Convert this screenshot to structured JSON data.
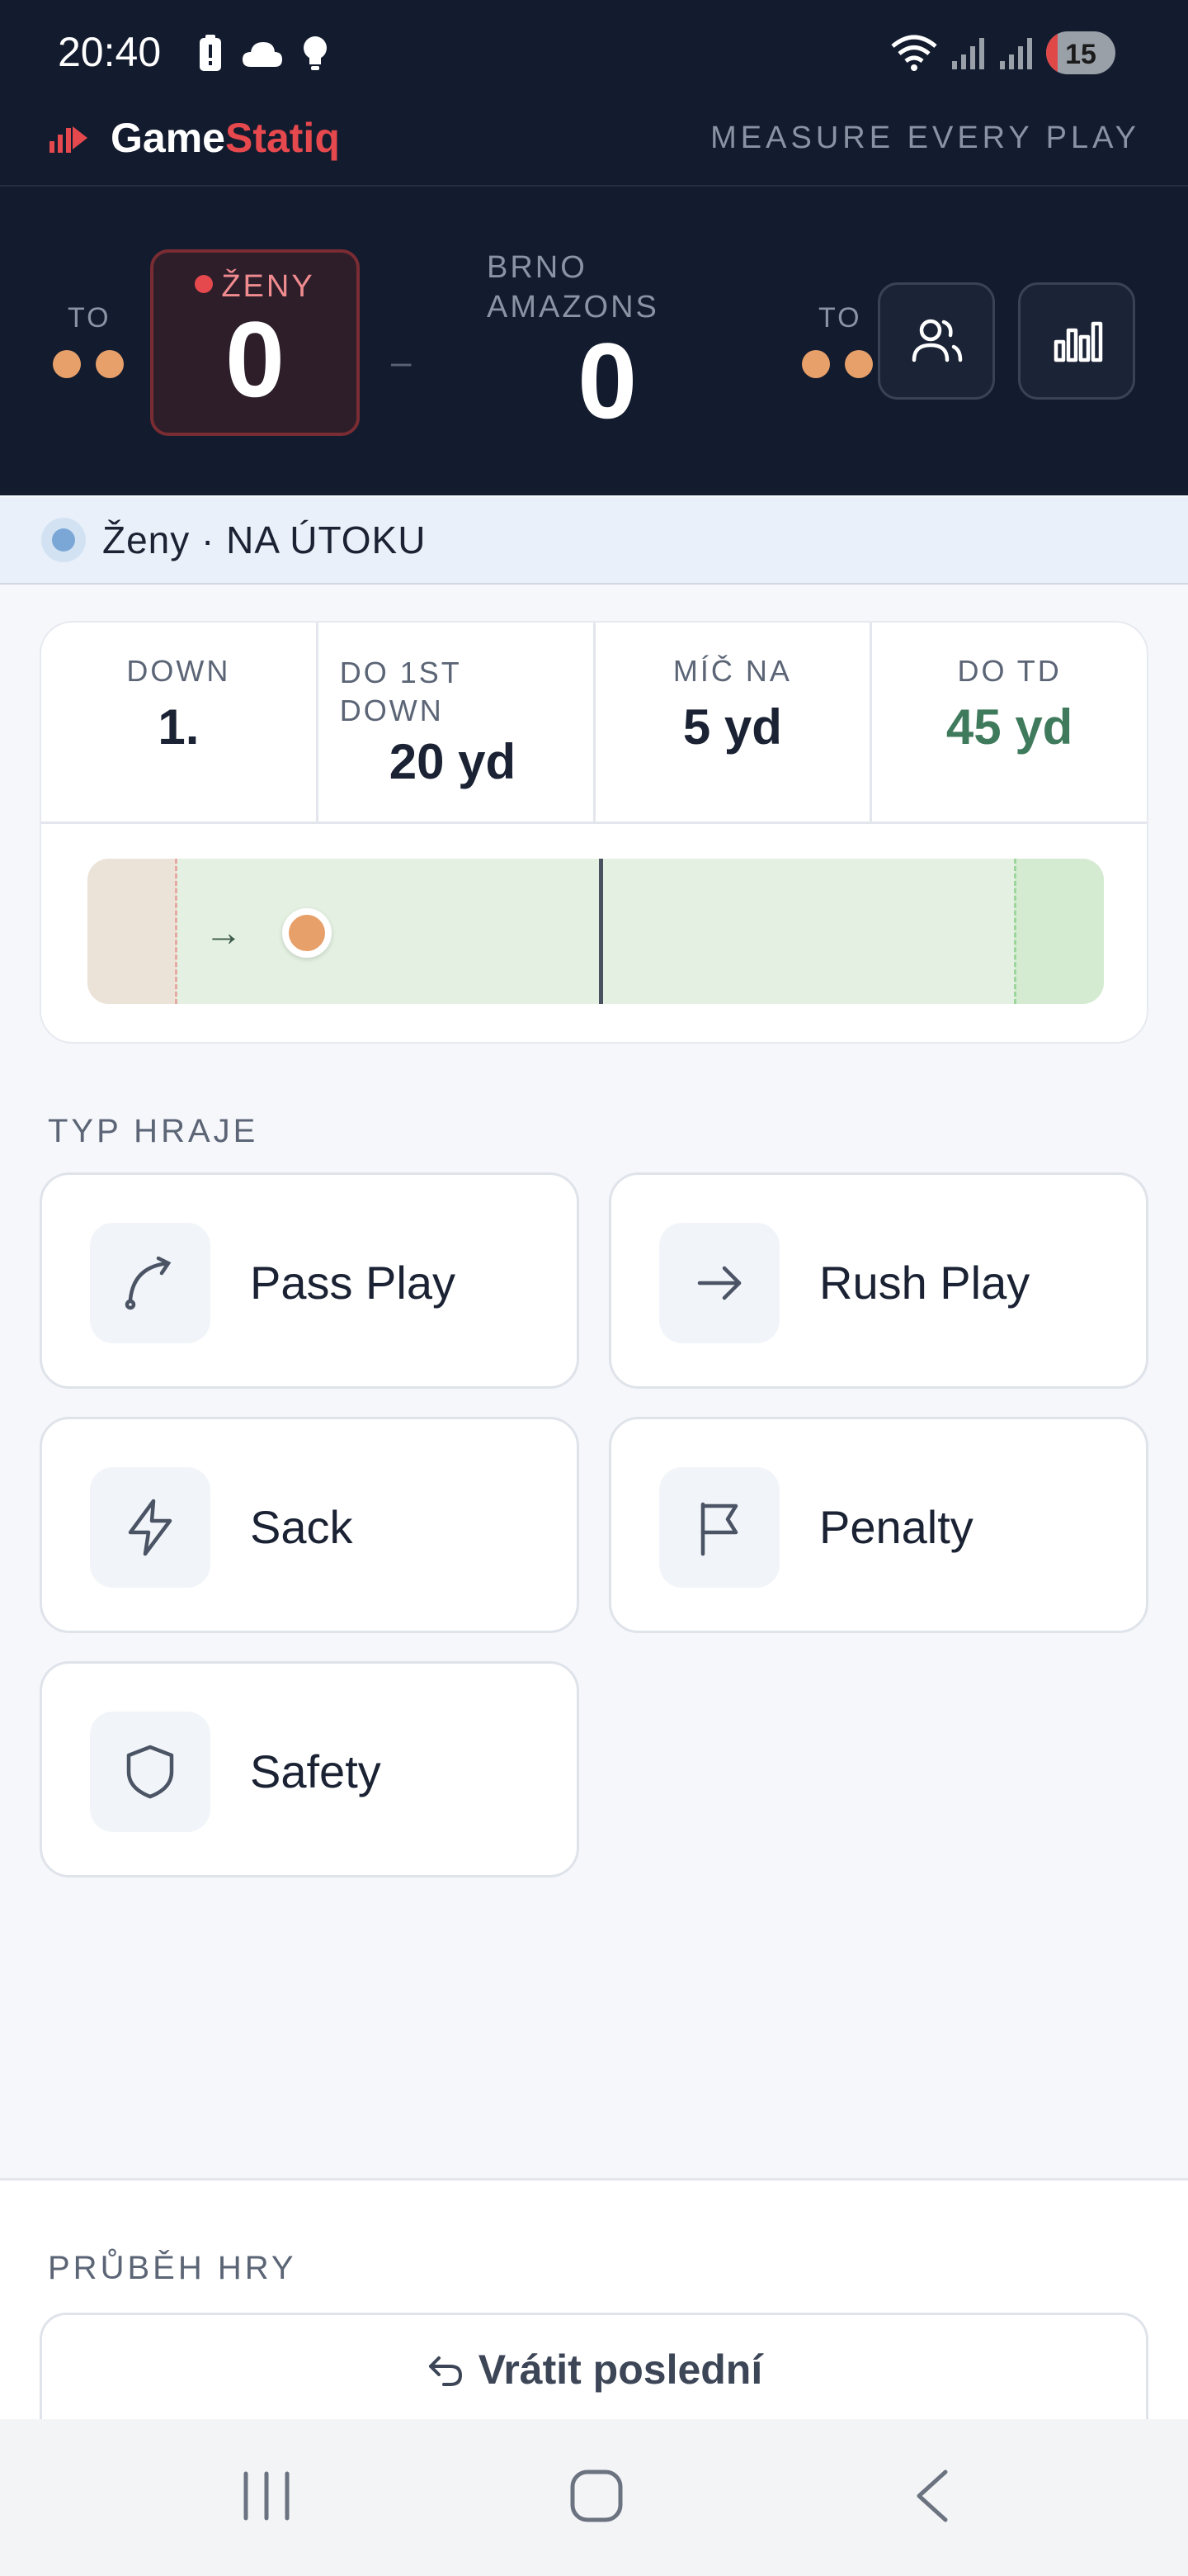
{
  "status_bar": {
    "time": "20:40",
    "battery_level": "15"
  },
  "app": {
    "brand_first": "Game",
    "brand_accent": "Statiq",
    "tagline": "MEASURE EVERY PLAY"
  },
  "scoreboard": {
    "home": {
      "to_label": "TO",
      "name": "ŽENY",
      "score": "0",
      "timeouts_remaining": 2
    },
    "separator": "–",
    "away": {
      "to_label": "TO",
      "name": "BRNO AMAZONS",
      "score": "0",
      "timeouts_remaining": 2
    }
  },
  "possession": {
    "text": "Ženy · NA ÚTOKU"
  },
  "game_state": {
    "down_label": "DOWN",
    "down_value": "1.",
    "to_first_label": "DO 1ST DOWN",
    "to_first_value": "20 yd",
    "ball_on_label": "MÍČ NA",
    "ball_on_value": "5 yd",
    "to_td_label": "DO TD",
    "to_td_value": "45 yd",
    "ball_arrow": "→"
  },
  "play_types": {
    "title": "TYP HRAJE",
    "items": [
      {
        "label": "Pass Play",
        "icon": "pass-curve-icon"
      },
      {
        "label": "Rush Play",
        "icon": "arrow-right-icon"
      },
      {
        "label": "Sack",
        "icon": "lightning-icon"
      },
      {
        "label": "Penalty",
        "icon": "flag-icon"
      },
      {
        "label": "Safety",
        "icon": "shield-icon"
      }
    ]
  },
  "timeline": {
    "title": "PRŮBĚH HRY",
    "undo_label": "Vrátit poslední"
  },
  "colors": {
    "accent": "#e5484d",
    "dark_bg": "#131b2e",
    "timeout_dot": "#e8a06a",
    "td_green": "#3f7a5c"
  }
}
